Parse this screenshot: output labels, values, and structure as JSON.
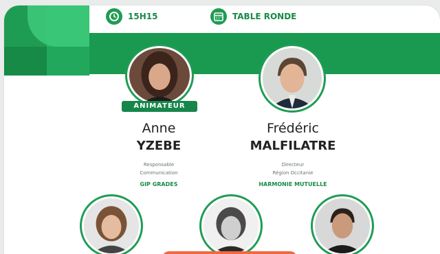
{
  "header": {
    "time": "15H15",
    "format": "TABLE RONDE"
  },
  "speakers": [
    {
      "badge": "ANIMATEUR",
      "first_name": "Anne",
      "last_name": "YZEBE",
      "role_line1": "Responsable",
      "role_line2": "Communication",
      "organization": "GIP GRADES"
    },
    {
      "first_name": "Frédéric",
      "last_name": "MALFILATRE",
      "role_line1": "Directeur",
      "role_line2": "Région Occitanie",
      "organization": "HARMONIE MUTUELLE"
    }
  ],
  "icons": {
    "time": "clock-icon",
    "format": "calendar-icon"
  },
  "colors": {
    "brand_green": "#1f9c54",
    "dark_green": "#17864a",
    "cta_orange": "#ef6a3e"
  }
}
